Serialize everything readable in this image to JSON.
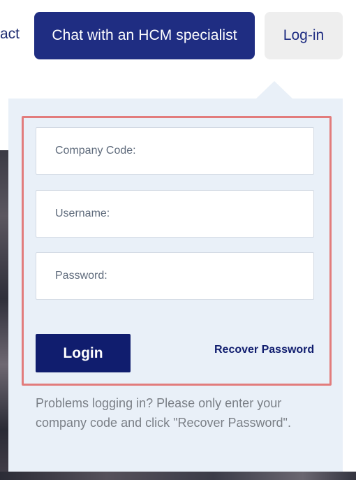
{
  "nav": {
    "contact_label": "act",
    "chat_button_label": "Chat with an HCM specialist",
    "login_tab_label": "Log-in"
  },
  "login_form": {
    "company_code_placeholder": "Company Code:",
    "username_placeholder": "Username:",
    "password_placeholder": "Password:",
    "submit_label": "Login",
    "recover_link_label": "Recover Password",
    "help_text": "Problems logging in? Please only enter your company code and click \"Recover Password\"."
  },
  "colors": {
    "brand_navy": "#1f2d82",
    "submit_navy": "#101d6e",
    "highlight_border": "#e27c7c",
    "panel_bg": "#e9f0f8"
  }
}
